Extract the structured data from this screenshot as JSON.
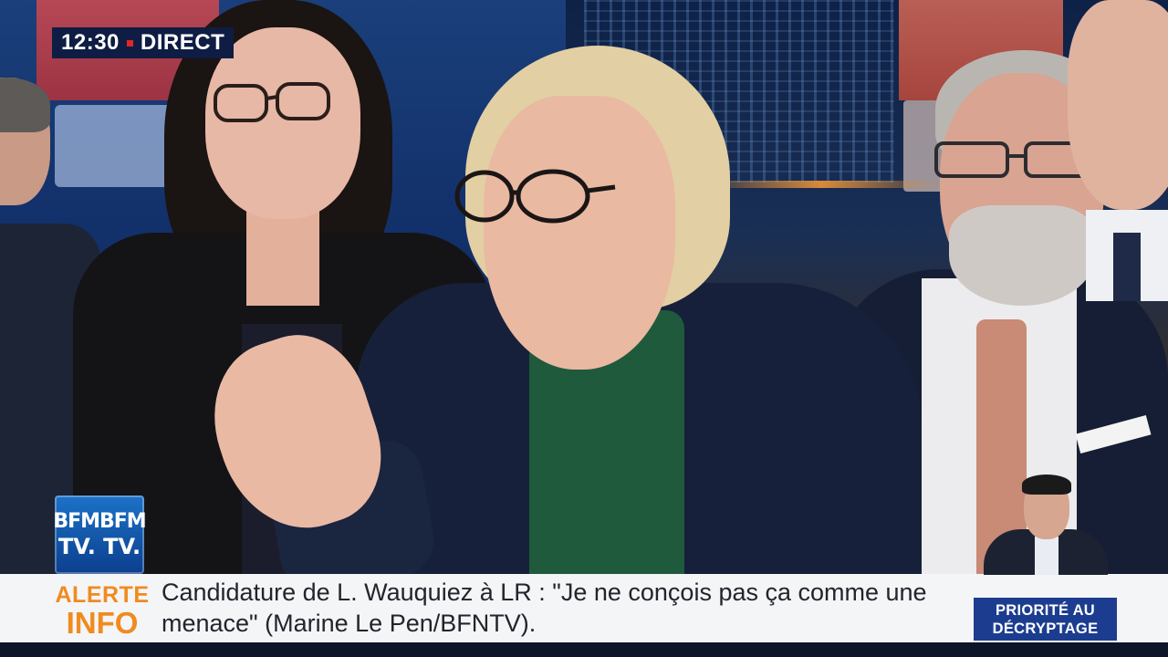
{
  "broadcast": {
    "time": "12:30",
    "status": "DIRECT"
  },
  "channel_logo": {
    "line1": "BFMBFM",
    "line2": "TV. TV."
  },
  "ticker": {
    "label_line1": "ALERTE",
    "label_line2": "INFO",
    "headline": "Candidature de L. Wauquiez à LR : \"Je ne conçois pas ça comme une menace\" (Marine Le Pen/BFNTV)."
  },
  "program_badge": {
    "line1": "PRIORITÉ AU",
    "line2": "DÉCRYPTAGE"
  },
  "colors": {
    "live_bg": "#0f1d44",
    "alert_orange": "#f08b1f",
    "badge_blue": "#1c3d8f",
    "ticker_bg": "#f4f5f7"
  }
}
